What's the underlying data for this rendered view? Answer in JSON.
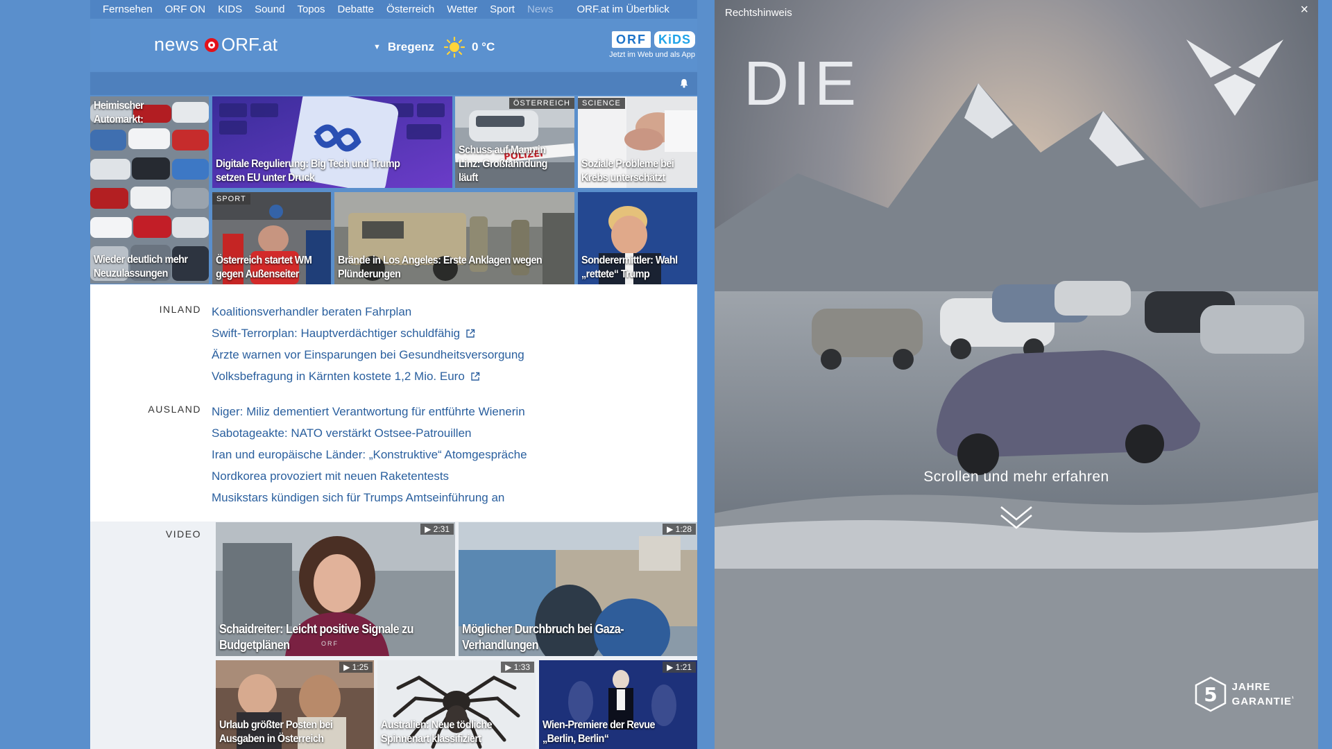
{
  "topnav": {
    "items": [
      "Fernsehen",
      "ORF ON",
      "KIDS",
      "Sound",
      "Topos",
      "Debatte",
      "Österreich",
      "Wetter",
      "Sport",
      "News"
    ],
    "overview": "ORF.at im Überblick"
  },
  "header": {
    "logo_news": "news",
    "logo_orf": "ORF.at",
    "weather_city": "Bregenz",
    "weather_temp": "0 °C",
    "kids_orf": "ORF",
    "kids_kids": "KiDS",
    "kids_tagline": "Jetzt im Web und als App"
  },
  "tiles": [
    {
      "title": "Heimischer Automarkt:",
      "subtitle": "Wieder deutlich mehr Neuzulassungen"
    },
    {
      "title": "Digitale Regulierung: Big Tech und Trump setzen EU unter Druck"
    },
    {
      "label": "ÖSTERREICH",
      "title": "Schuss auf Mann in Linz: Großfahndung läuft"
    },
    {
      "label": "SCIENCE",
      "title": "Soziale Probleme bei Krebs unterschätzt"
    },
    {
      "label": "SPORT",
      "title": "Österreich startet WM gegen Außenseiter"
    },
    {
      "title": "Brände in Los Angeles: Erste Anklagen wegen Plünderungen"
    },
    {
      "title": "Sonderermittler: Wahl „rettete“ Trump"
    }
  ],
  "inland": {
    "label": "INLAND",
    "links": [
      "Koalitionsverhandler beraten Fahrplan",
      "Swift-Terrorplan: Hauptverdächtiger schuldfähig",
      "Ärzte warnen vor Einsparungen bei Gesundheitsversorgung",
      "Volksbefragung in Kärnten kostete 1,2 Mio. Euro"
    ]
  },
  "ausland": {
    "label": "AUSLAND",
    "links": [
      "Niger: Miliz dementiert Verantwortung für entführte Wienerin",
      "Sabotageakte: NATO verstärkt Ostsee-Patrouillen",
      "Iran und europäische Länder: „Konstruktive“ Atomgespräche",
      "Nordkorea provoziert mit neuen Raketentests",
      "Musikstars kündigen sich für Trumps Amtseinführung an"
    ]
  },
  "video": {
    "label": "VIDEO",
    "items": [
      {
        "duration": "▶ 2:31",
        "title": "Schaidreiter: Leicht positive Signale zu Budgetplänen",
        "tag": "ORF"
      },
      {
        "duration": "▶ 1:28",
        "title": "Möglicher Durchbruch bei Gaza-Verhandlungen"
      },
      {
        "duration": "▶ 1:25",
        "title": "Urlaub größter Posten bei Ausgaben in Österreich"
      },
      {
        "duration": "▶ 1:33",
        "title": "Australien: Neue tödliche Spinnenart klassifiziert"
      },
      {
        "duration": "▶ 1:21",
        "title": "Wien-Premiere der Revue „Berlin, Berlin“"
      }
    ]
  },
  "ad": {
    "legal": "Rechtshinweis",
    "close": "×",
    "headline": "DIE",
    "scroll": "Scrollen und mehr erfahren",
    "guarantee_number": "5",
    "guarantee_line1": "JAHRE",
    "guarantee_line2": "GARANTIE",
    "guarantee_mark": "¹"
  }
}
